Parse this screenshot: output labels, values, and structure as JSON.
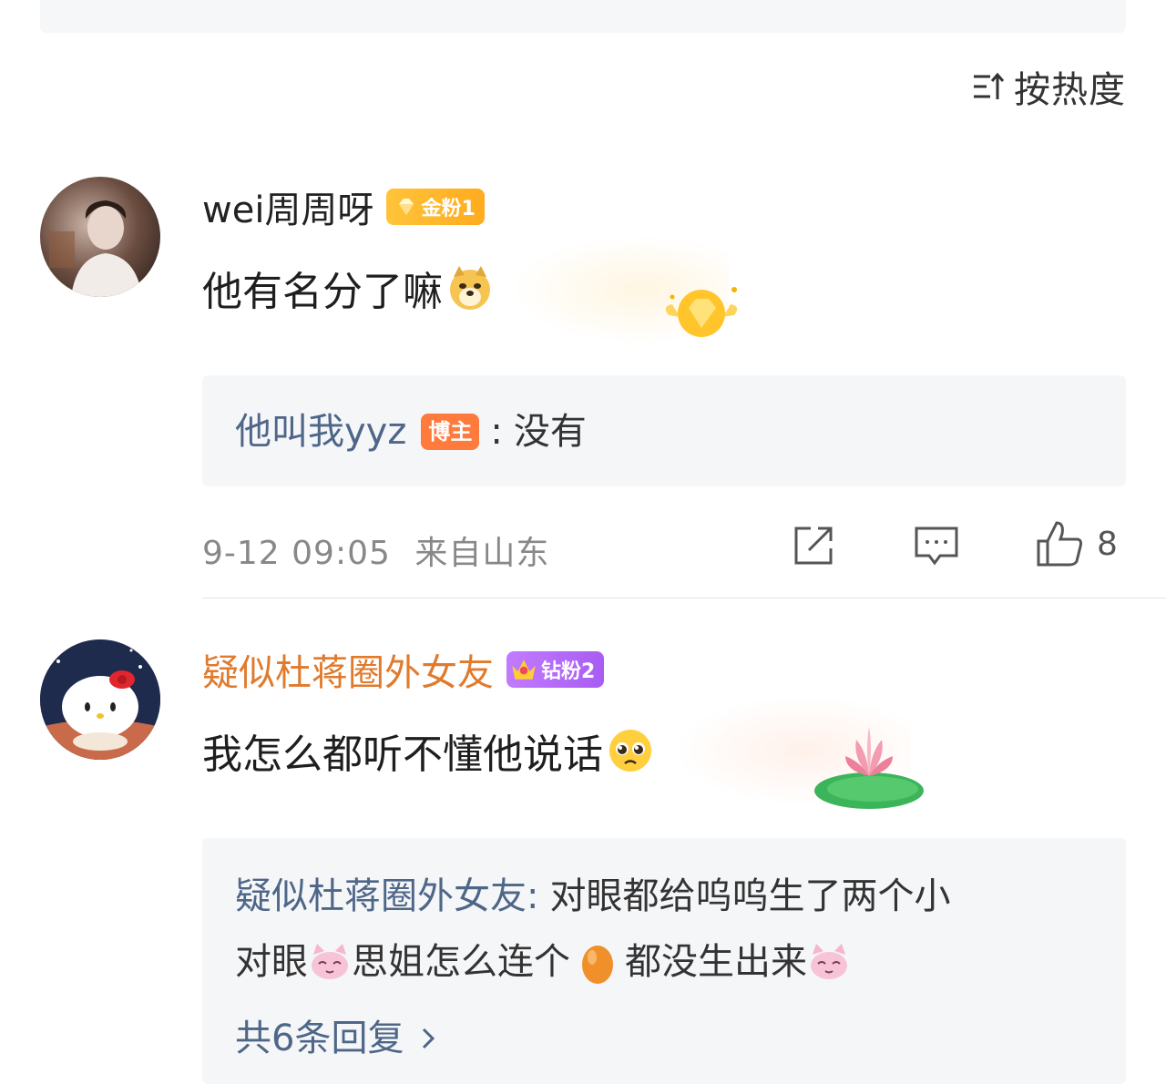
{
  "sort": {
    "label": "按热度",
    "icon": "sort-icon"
  },
  "comments": [
    {
      "username": "wei周周呀",
      "badge": {
        "label": "金粉1",
        "color": "#ffb627",
        "icon": "diamond-gem-icon"
      },
      "text": "他有名分了嘛",
      "emoji": "doge-emoji",
      "reply": {
        "user": "他叫我yyz",
        "author_tag": "博主",
        "separator": ":",
        "text": "没有"
      },
      "time": "9-12 09:05",
      "location": "来自山东",
      "actions": {
        "share_icon": "share-icon",
        "comment_icon": "comment-icon",
        "like_icon": "like-icon",
        "like_count": "8"
      }
    },
    {
      "username": "疑似杜蒋圈外女友",
      "username_color": "#e07a2c",
      "badge": {
        "label": "钻粉2",
        "color": "#b16cf8",
        "icon": "crown-icon"
      },
      "text": "我怎么都听不懂他说话",
      "emoji": "pleading-emoji",
      "reply": {
        "user": "疑似杜蒋圈外女友",
        "separator": ":",
        "line1": "对眼都给呜呜生了两个小",
        "line2_a": "对眼",
        "line2_b": "思姐怎么连个",
        "line2_c": "都没生出来",
        "more": "共6条回复"
      }
    }
  ]
}
